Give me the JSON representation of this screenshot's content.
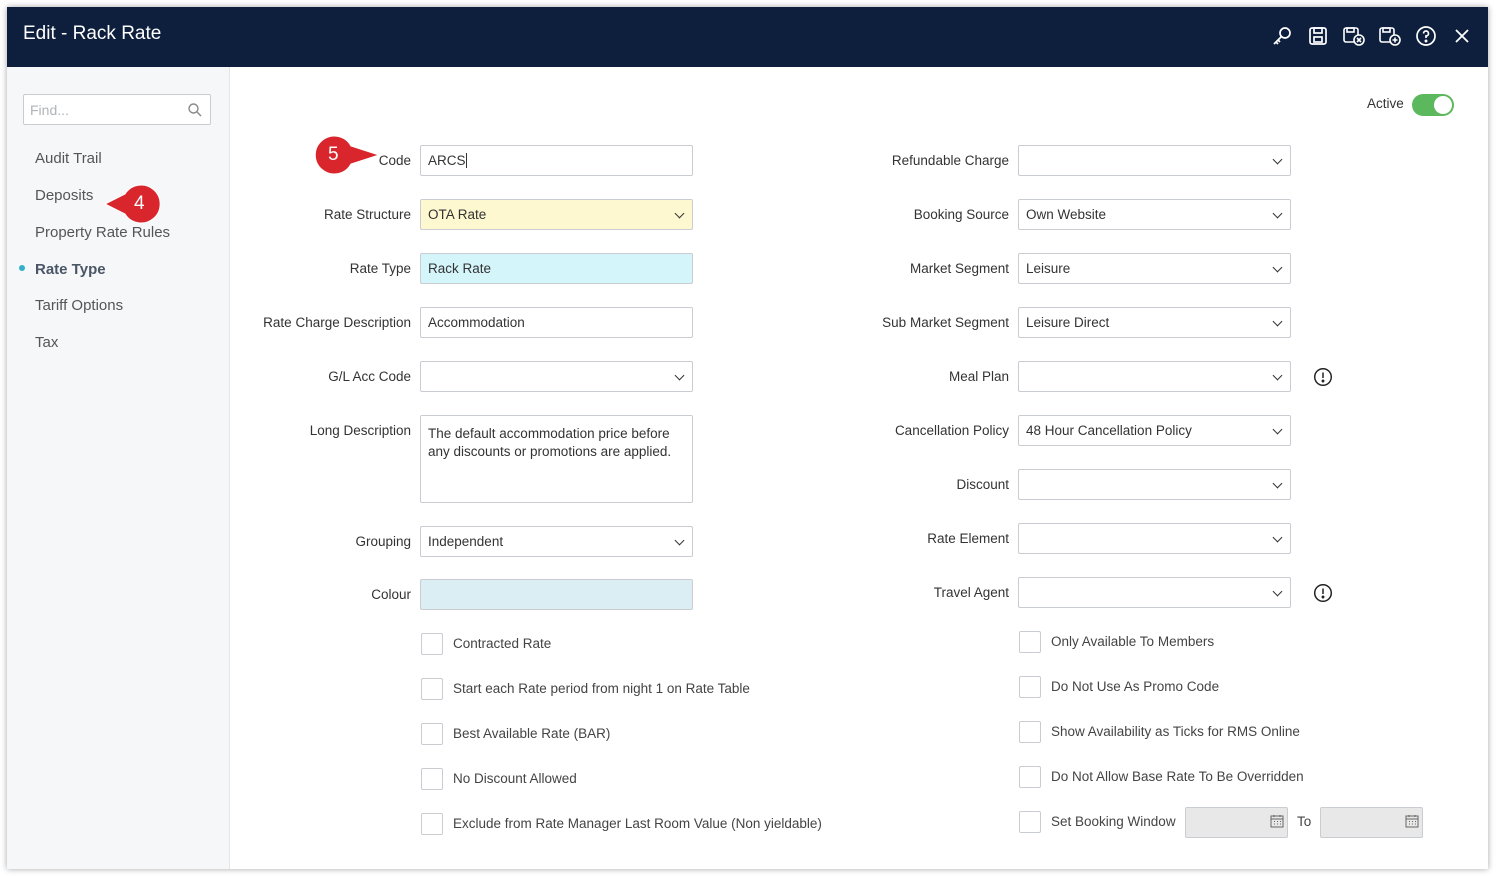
{
  "window": {
    "title": "Edit - Rack Rate"
  },
  "toolbar": {
    "icons": [
      "key-icon",
      "save-icon",
      "save-and-close-icon",
      "save-and-new-icon",
      "help-icon",
      "close-icon"
    ]
  },
  "sidebar": {
    "search_placeholder": "Find...",
    "items": [
      {
        "label": "Audit Trail"
      },
      {
        "label": "Deposits"
      },
      {
        "label": "Property Rate Rules"
      },
      {
        "label": "Rate Type"
      },
      {
        "label": "Tariff Options"
      },
      {
        "label": "Tax"
      }
    ],
    "active_index": 3
  },
  "callouts": {
    "step4": "4",
    "step5": "5",
    "color": "#d9262d"
  },
  "active": {
    "label": "Active",
    "on": true,
    "color": "#5cb85c"
  },
  "left_form": {
    "code": {
      "label": "Code",
      "value": "ARCS"
    },
    "rate_structure": {
      "label": "Rate Structure",
      "value": "OTA Rate"
    },
    "rate_type": {
      "label": "Rate Type",
      "value": "Rack Rate"
    },
    "rate_charge_description": {
      "label": "Rate Charge Description",
      "value": "Accommodation"
    },
    "gl_acc_code": {
      "label": "G/L Acc Code",
      "value": ""
    },
    "long_description": {
      "label": "Long Description",
      "value": "The default accommodation price before any discounts or promotions are applied."
    },
    "grouping": {
      "label": "Grouping",
      "value": "Independent"
    },
    "colour": {
      "label": "Colour",
      "value": ""
    }
  },
  "right_form": {
    "refundable_charge": {
      "label": "Refundable Charge",
      "value": ""
    },
    "booking_source": {
      "label": "Booking Source",
      "value": "Own Website"
    },
    "market_segment": {
      "label": "Market Segment",
      "value": "Leisure"
    },
    "sub_market_segment": {
      "label": "Sub Market Segment",
      "value": "Leisure Direct"
    },
    "meal_plan": {
      "label": "Meal Plan",
      "value": ""
    },
    "cancellation_policy": {
      "label": "Cancellation Policy",
      "value": "48 Hour Cancellation Policy"
    },
    "discount": {
      "label": "Discount",
      "value": ""
    },
    "rate_element": {
      "label": "Rate Element",
      "value": ""
    },
    "travel_agent": {
      "label": "Travel Agent",
      "value": ""
    }
  },
  "left_checks": [
    {
      "label": "Contracted Rate",
      "checked": false
    },
    {
      "label": "Start each Rate period from night 1 on Rate Table",
      "checked": false
    },
    {
      "label": "Best Available Rate (BAR)",
      "checked": false
    },
    {
      "label": "No Discount Allowed",
      "checked": false
    },
    {
      "label": "Exclude from Rate Manager Last Room Value (Non yieldable)",
      "checked": false
    }
  ],
  "right_checks": [
    {
      "label": "Only Available To Members",
      "checked": false
    },
    {
      "label": "Do Not Use As Promo Code",
      "checked": false
    },
    {
      "label": "Show Availability as Ticks for RMS Online",
      "checked": false
    },
    {
      "label": "Do Not Allow Base Rate To Be Overridden",
      "checked": false
    },
    {
      "label": "Set Booking Window",
      "checked": false
    }
  ],
  "booking_window": {
    "to_label": "To",
    "from_value": "",
    "to_value": ""
  }
}
